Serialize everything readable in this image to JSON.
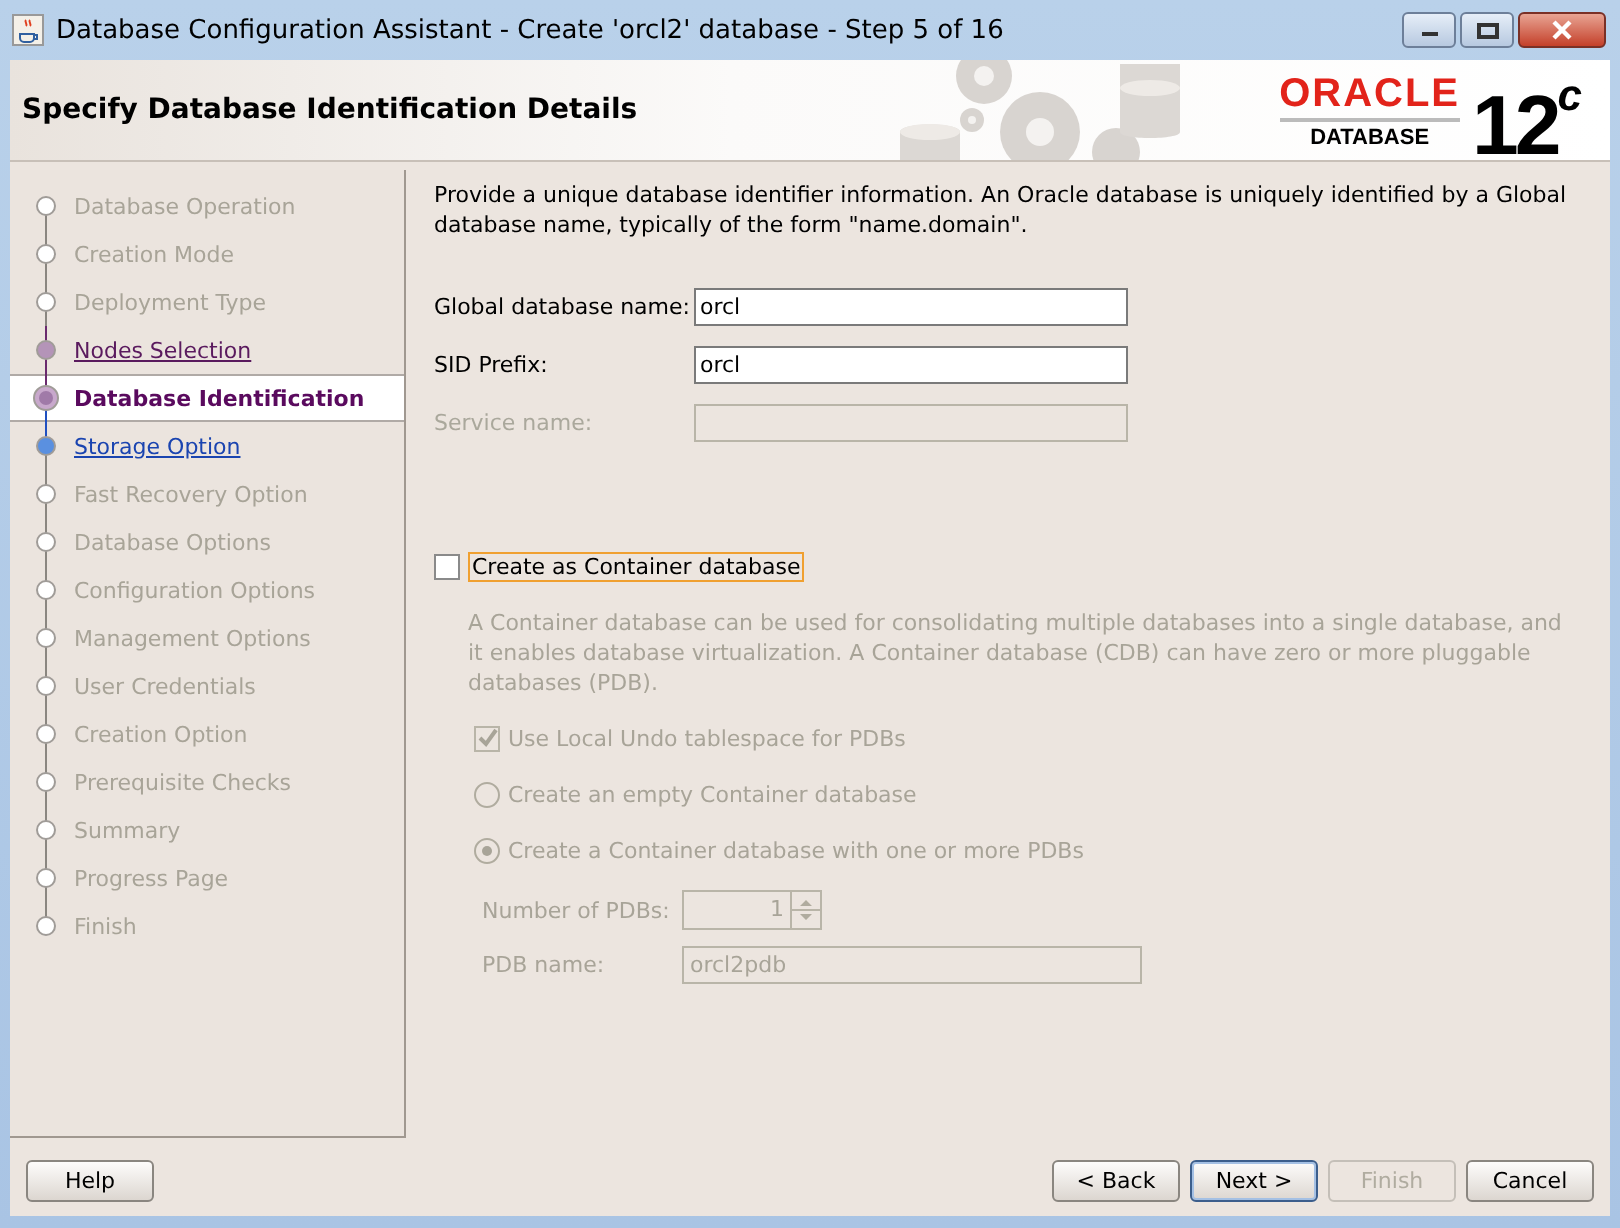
{
  "window": {
    "title": "Database Configuration Assistant - Create 'orcl2' database - Step 5 of 16"
  },
  "header": {
    "title": "Specify Database Identification Details",
    "logo": {
      "brand": "ORACLE",
      "product": "DATABASE",
      "version": "12$^{c}$"
    }
  },
  "steps": [
    {
      "label": "Database Operation",
      "disabled": true,
      "visited": false,
      "selected": false
    },
    {
      "label": "Creation Mode",
      "disabled": true,
      "visited": false,
      "selected": false
    },
    {
      "label": "Deployment Type",
      "disabled": true,
      "visited": false,
      "selected": false
    },
    {
      "label": "Nodes Selection",
      "disabled": false,
      "visited": true,
      "selected": false
    },
    {
      "label": "Database Identification",
      "disabled": false,
      "visited": false,
      "selected": true
    },
    {
      "label": "Storage Option",
      "disabled": false,
      "visited": false,
      "selected": false
    },
    {
      "label": "Fast Recovery Option",
      "disabled": true,
      "visited": false,
      "selected": false
    },
    {
      "label": "Database Options",
      "disabled": true,
      "visited": false,
      "selected": false
    },
    {
      "label": "Configuration Options",
      "disabled": true,
      "visited": false,
      "selected": false
    },
    {
      "label": "Management Options",
      "disabled": true,
      "visited": false,
      "selected": false
    },
    {
      "label": "User Credentials",
      "disabled": true,
      "visited": false,
      "selected": false
    },
    {
      "label": "Creation Option",
      "disabled": true,
      "visited": false,
      "selected": false
    },
    {
      "label": "Prerequisite Checks",
      "disabled": true,
      "visited": false,
      "selected": false
    },
    {
      "label": "Summary",
      "disabled": true,
      "visited": false,
      "selected": false
    },
    {
      "label": "Progress Page",
      "disabled": true,
      "visited": false,
      "selected": false
    },
    {
      "label": "Finish",
      "disabled": true,
      "visited": false,
      "selected": false
    }
  ],
  "intro": "Provide a unique database identifier information. An Oracle database is uniquely identified by a Global database name, typically of the form \"name.domain\".",
  "fields": [
    {
      "label": "Global database name:",
      "value": "orcl",
      "disabled": false
    },
    {
      "label": "SID Prefix:",
      "value": "orcl",
      "disabled": false
    },
    {
      "label": "Service name:",
      "disabled": true
    }
  ],
  "container": {
    "label": "Create as Container database",
    "checked": false,
    "focused": true,
    "description": "A Container database can be used for consolidating multiple databases into a single database, and it enables database virtualization. A Container database (CDB) can have zero or more pluggable databases (PDB).",
    "options": [
      {
        "kind": "checkbox",
        "label": "Use Local Undo tablespace for PDBs",
        "checked": true
      },
      {
        "kind": "radio",
        "label": "Create an empty Container database",
        "selected": false
      },
      {
        "kind": "radio",
        "label": "Create a Container database with one or more PDBs",
        "selected": true
      }
    ],
    "pdb_count": {
      "label": "Number of PDBs:",
      "value": "1"
    },
    "pdb_name": {
      "label": "PDB name:",
      "value": "orcl2pdb"
    }
  },
  "left_buttons": [
    {
      "label": "Help",
      "disabled": false,
      "default": false
    }
  ],
  "right_buttons": [
    {
      "label": "< Back",
      "disabled": false,
      "default": false
    },
    {
      "label": "Next >",
      "disabled": false,
      "default": true
    },
    {
      "label": "Finish",
      "disabled": true,
      "default": false
    },
    {
      "label": "Cancel",
      "disabled": false,
      "default": false
    }
  ]
}
